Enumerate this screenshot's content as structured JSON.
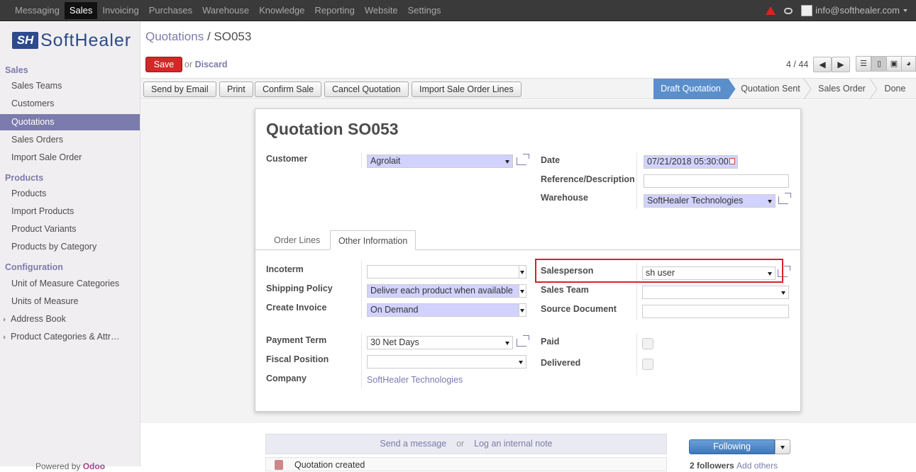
{
  "topbar": {
    "menu": [
      "Messaging",
      "Sales",
      "Invoicing",
      "Purchases",
      "Warehouse",
      "Knowledge",
      "Reporting",
      "Website",
      "Settings"
    ],
    "active": "Sales",
    "user": "info@softhealer.com"
  },
  "sidebar": {
    "logo_mark": "SH",
    "logo_text": "SoftHealer",
    "sections": {
      "sales": "Sales",
      "products": "Products",
      "configuration": "Configuration"
    },
    "sales_items": [
      "Sales Teams",
      "Customers",
      "Quotations",
      "Sales Orders",
      "Import Sale Order"
    ],
    "product_items": [
      "Products",
      "Import Products",
      "Product Variants",
      "Products by Category"
    ],
    "config_items": [
      "Unit of Measure Categories",
      "Units of Measure",
      "Address Book",
      "Product Categories & Attr…"
    ],
    "powered_prefix": "Powered by",
    "powered_brand": "Odoo"
  },
  "header": {
    "breadcrumb_parent": "Quotations",
    "breadcrumb_sep": " / ",
    "breadcrumb_current": "SO053",
    "save": "Save",
    "or": "or",
    "discard": "Discard",
    "pager": "4 / 44"
  },
  "actions": [
    "Send by Email",
    "Print",
    "Confirm Sale",
    "Cancel Quotation",
    "Import Sale Order Lines"
  ],
  "stages": [
    "Draft Quotation",
    "Quotation Sent",
    "Sales Order",
    "Done"
  ],
  "form": {
    "title": "Quotation SO053",
    "customer_label": "Customer",
    "customer_value": "Agrolait",
    "date_label": "Date",
    "date_value": "07/21/2018 05:30:00",
    "reference_label": "Reference/Description",
    "reference_value": "",
    "warehouse_label": "Warehouse",
    "warehouse_value": "SoftHealer Technologies",
    "tabs": [
      "Order Lines",
      "Other Information"
    ],
    "incoterm_label": "Incoterm",
    "incoterm_value": "",
    "shipping_label": "Shipping Policy",
    "shipping_value": "Deliver each product when available",
    "invoice_label": "Create Invoice",
    "invoice_value": "On Demand",
    "salesperson_label": "Salesperson",
    "salesperson_value": "sh user",
    "team_label": "Sales Team",
    "team_value": "",
    "source_label": "Source Document",
    "source_value": "",
    "payment_label": "Payment Term",
    "payment_value": "30 Net Days",
    "fiscal_label": "Fiscal Position",
    "fiscal_value": "",
    "company_label": "Company",
    "company_value": "SoftHealer Technologies",
    "paid_label": "Paid",
    "delivered_label": "Delivered"
  },
  "chatter": {
    "send": "Send a message",
    "or": "or",
    "log": "Log an internal note",
    "following": "Following",
    "followers": "2 followers",
    "add_others": "Add others",
    "msg": "Quotation created"
  }
}
